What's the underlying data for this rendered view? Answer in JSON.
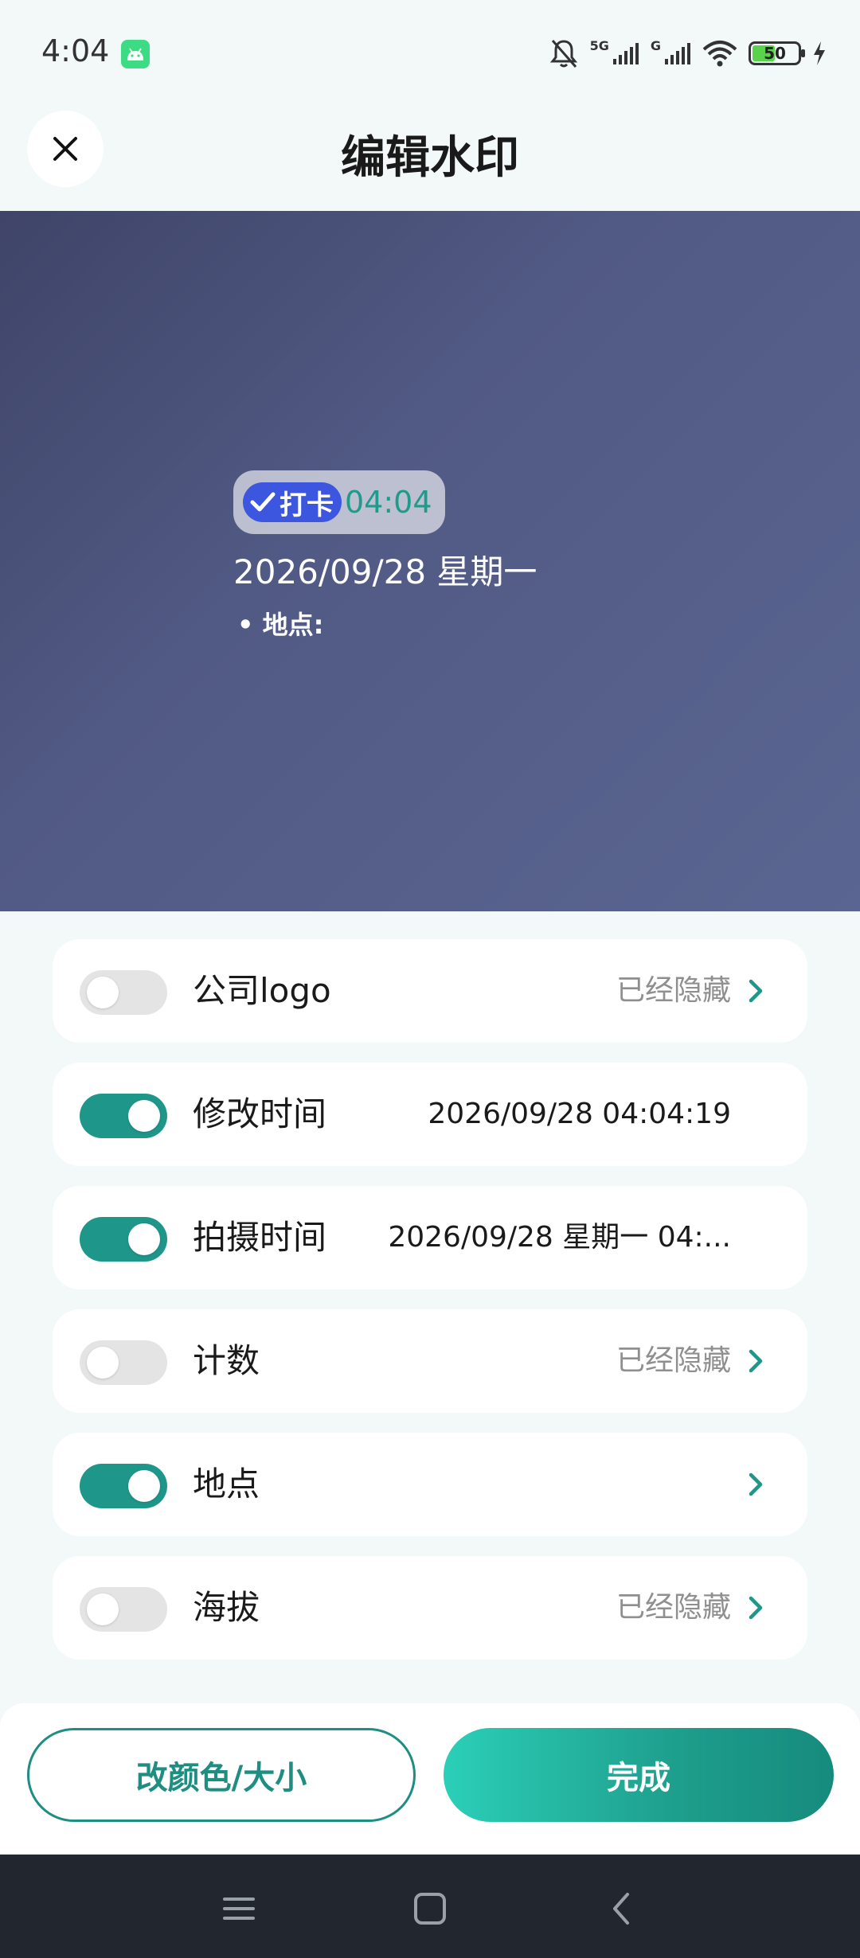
{
  "status_bar": {
    "time": "4:04",
    "signal1_label": "5G",
    "signal2_label": "G",
    "battery_level": "50",
    "battery_fraction": 0.5
  },
  "header": {
    "title": "编辑水印",
    "close_icon": "close-icon"
  },
  "preview": {
    "badge_label": "打卡",
    "badge_time": "04:04",
    "date_line": "2026/09/28 星期一",
    "location_line": "• 地点:"
  },
  "settings": [
    {
      "label": "公司logo",
      "enabled": false,
      "value": "已经隐藏",
      "has_arrow": true
    },
    {
      "label": "修改时间",
      "enabled": true,
      "value": "2026/09/28 04:04:19",
      "has_arrow": false
    },
    {
      "label": "拍摄时间",
      "enabled": true,
      "value": "2026/09/28 星期一 04:...",
      "has_arrow": false
    },
    {
      "label": "计数",
      "enabled": false,
      "value": "已经隐藏",
      "has_arrow": true
    },
    {
      "label": "地点",
      "enabled": true,
      "value": "",
      "has_arrow": true
    },
    {
      "label": "海拔",
      "enabled": false,
      "value": "已经隐藏",
      "has_arrow": true
    }
  ],
  "actions": {
    "change_style_label": "改颜色/大小",
    "done_label": "完成"
  },
  "colors": {
    "accent": "#1e968a",
    "done_gradient_start": "#2bcfb8",
    "done_gradient_end": "#168b7d",
    "badge_blue": "#3c56e0",
    "nav_bar": "#21262f"
  },
  "nav": {
    "icons": [
      "menu-icon",
      "home-icon",
      "back-icon"
    ]
  }
}
